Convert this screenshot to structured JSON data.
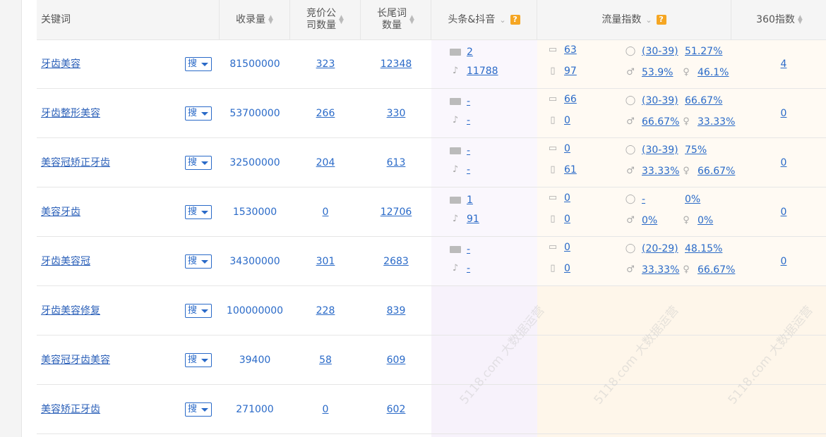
{
  "header": {
    "keyword": "关键词",
    "index_count": "收录量",
    "bid_line1": "竞价公",
    "bid_line2": "司数量",
    "longtail_line1": "长尾词",
    "longtail_line2": "数量",
    "toutiao": "头条&抖音",
    "flow": "流量指数",
    "s360": "360指数",
    "help": "?"
  },
  "search_label": "搜",
  "rows": [
    {
      "keyword": "牙齿美容",
      "index_count": "81500000",
      "bid": "323",
      "longtail": "12348",
      "toutiao": "2",
      "douyin": "11788",
      "pc": "63",
      "mobile": "97",
      "age": "(30-39)",
      "age_pct": "51.27%",
      "male": "53.9%",
      "female": "46.1%",
      "s360": "4"
    },
    {
      "keyword": "牙齿整形美容",
      "index_count": "53700000",
      "bid": "266",
      "longtail": "330",
      "toutiao": "-",
      "douyin": "-",
      "pc": "66",
      "mobile": "0",
      "age": "(30-39)",
      "age_pct": "66.67%",
      "male": "66.67%",
      "female": "33.33%",
      "s360": "0"
    },
    {
      "keyword": "美容冠矫正牙齿",
      "index_count": "32500000",
      "bid": "204",
      "longtail": "613",
      "toutiao": "-",
      "douyin": "-",
      "pc": "0",
      "mobile": "61",
      "age": "(30-39)",
      "age_pct": "75%",
      "male": "33.33%",
      "female": "66.67%",
      "s360": "0"
    },
    {
      "keyword": "美容牙齿",
      "index_count": "1530000",
      "bid": "0",
      "longtail": "12706",
      "toutiao": "1",
      "douyin": "91",
      "pc": "0",
      "mobile": "0",
      "age": "-",
      "age_pct": "0%",
      "male": "0%",
      "female": "0%",
      "s360": "0"
    },
    {
      "keyword": "牙齿美容冠",
      "index_count": "34300000",
      "bid": "301",
      "longtail": "2683",
      "toutiao": "-",
      "douyin": "-",
      "pc": "0",
      "mobile": "0",
      "age": "(20-29)",
      "age_pct": "48.15%",
      "male": "33.33%",
      "female": "66.67%",
      "s360": "0"
    },
    {
      "keyword": "牙齿美容修复",
      "index_count": "100000000",
      "bid": "228",
      "longtail": "839"
    },
    {
      "keyword": "美容冠牙齿美容",
      "index_count": "39400",
      "bid": "58",
      "longtail": "609"
    },
    {
      "keyword": "美容矫正牙齿",
      "index_count": "271000",
      "bid": "0",
      "longtail": "602"
    }
  ],
  "watermark": "5118.com 大数据运营",
  "icons": {
    "sort": "sort-icon",
    "toutiao": "toutiao-icon",
    "douyin": "douyin-icon",
    "pc": "pc-monitor-icon",
    "mobile": "mobile-icon",
    "person": "person-icon",
    "male": "male-icon",
    "female": "female-icon"
  }
}
